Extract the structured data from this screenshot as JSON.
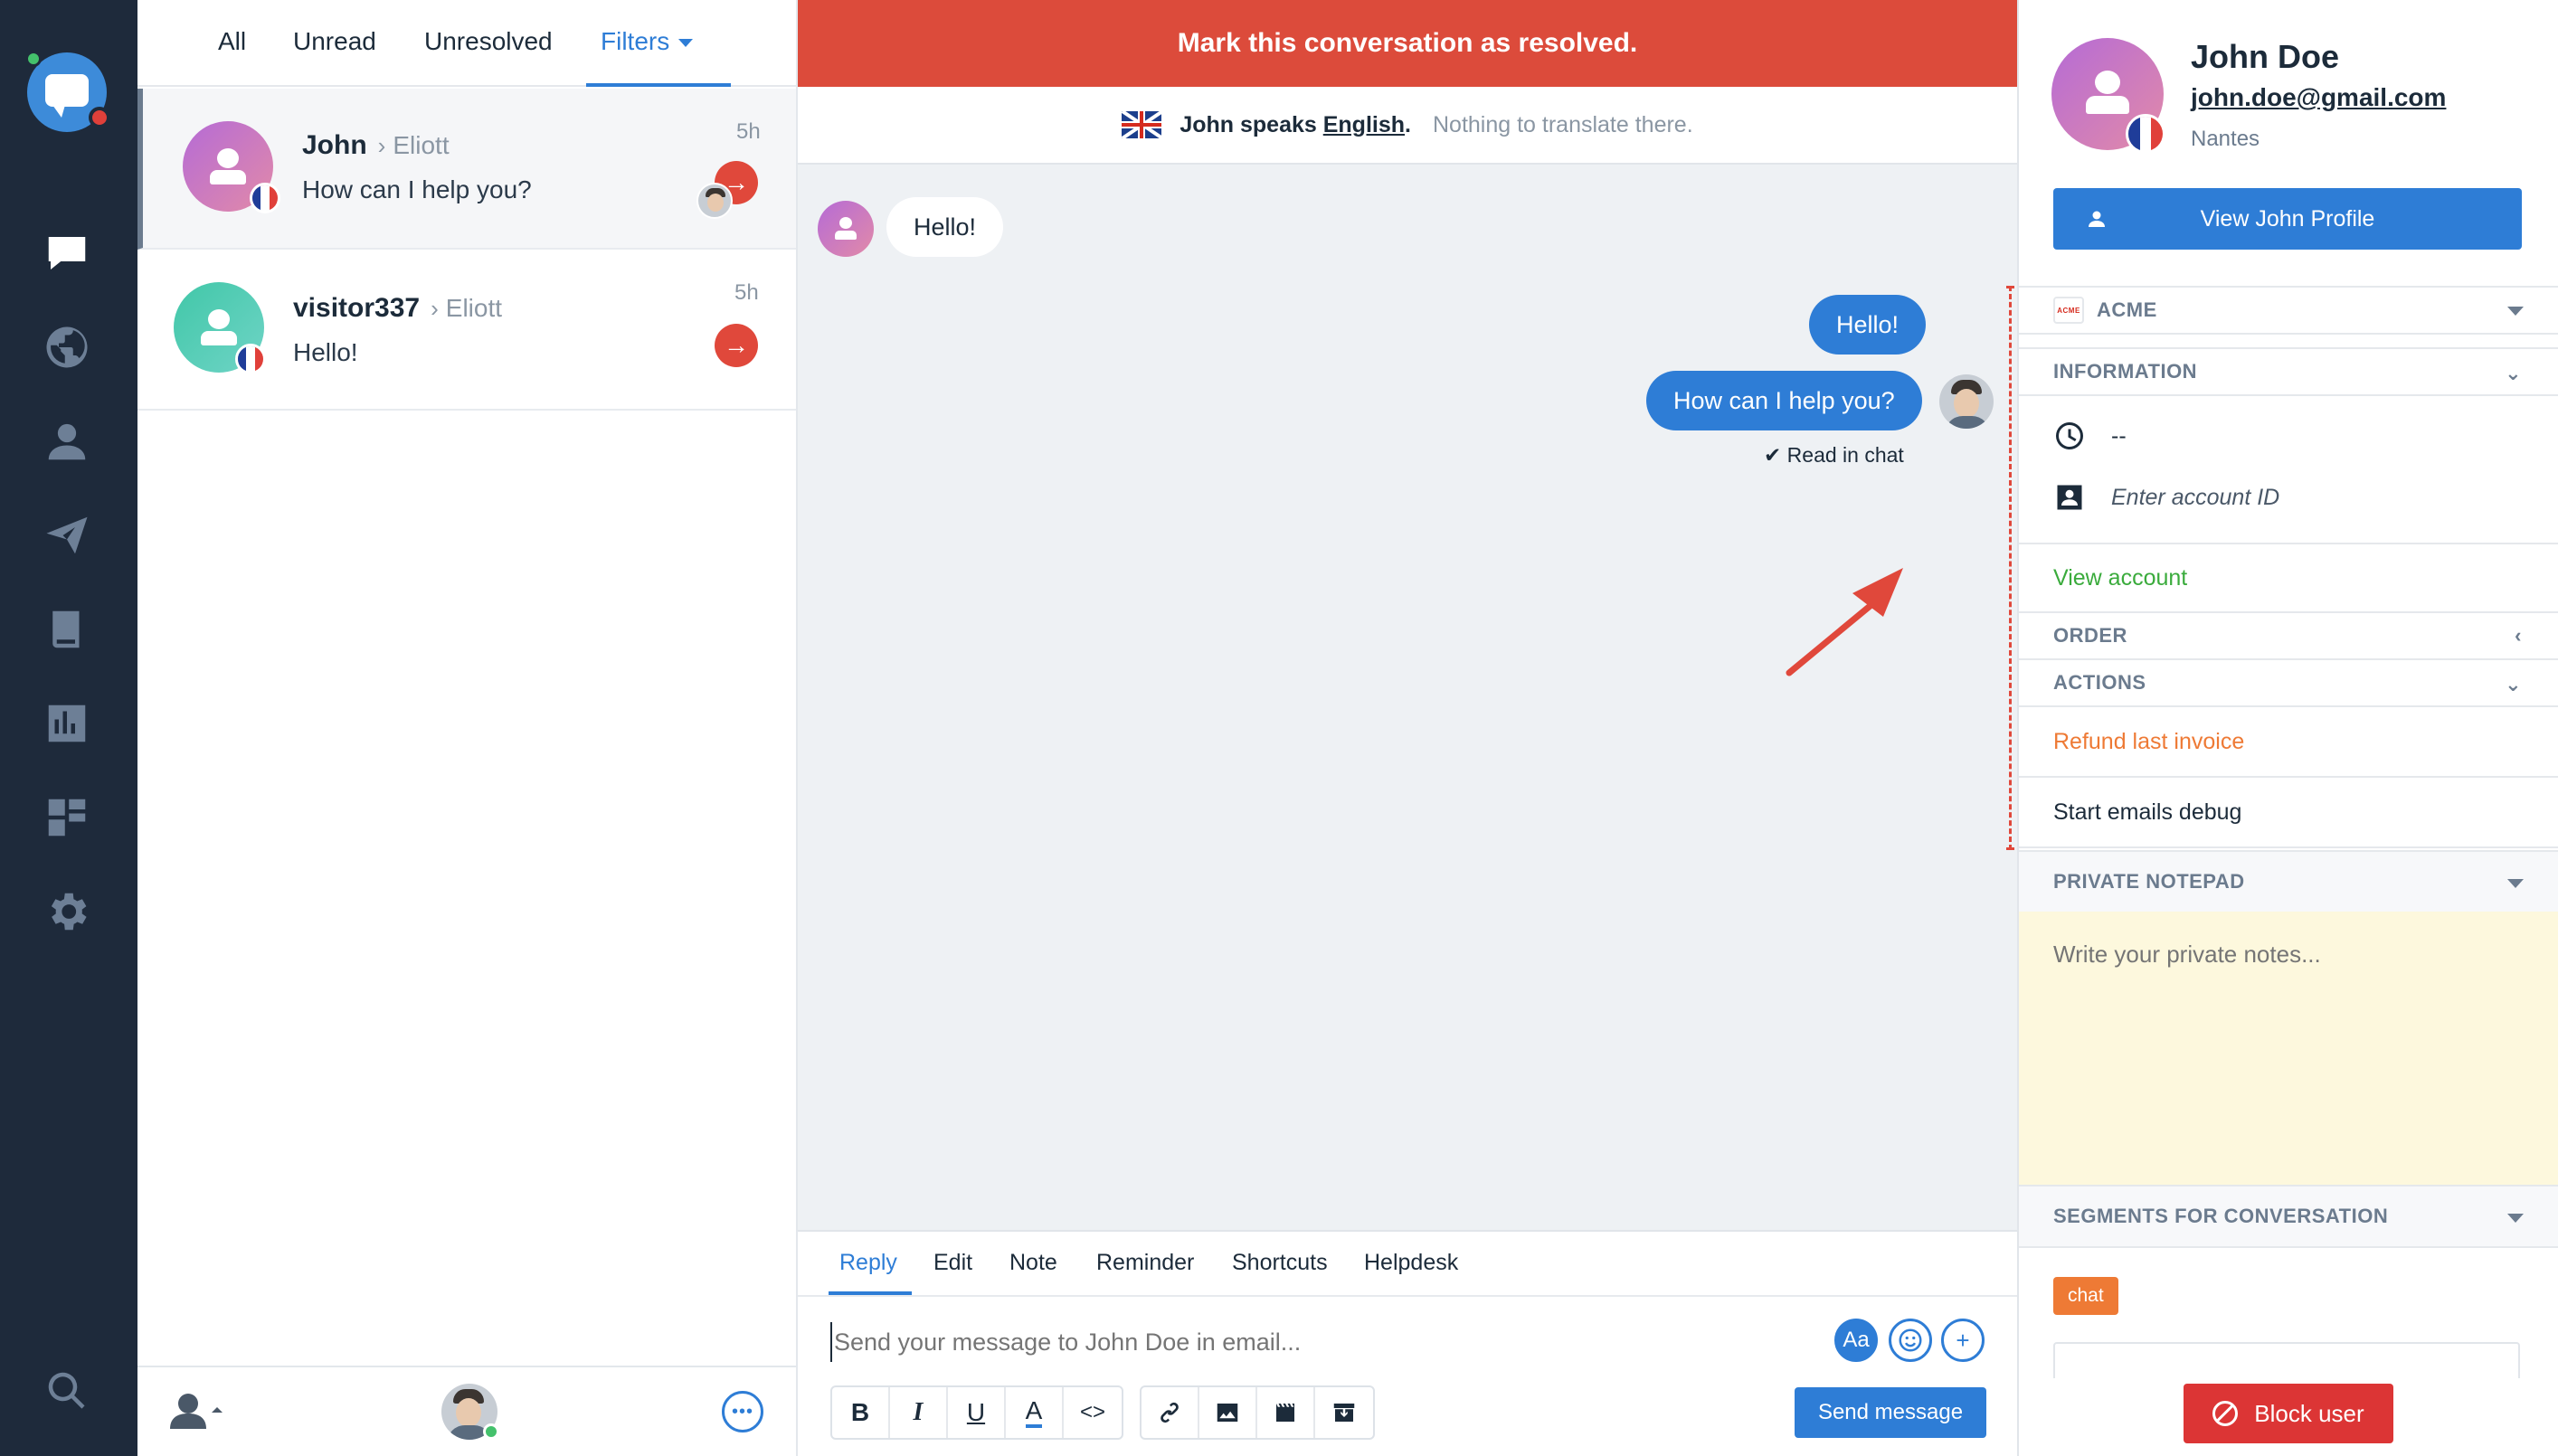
{
  "colors": {
    "brand_blue": "#2e7dd6",
    "resolve_red": "#dc4b3b",
    "rail_bg": "#1e2a3b",
    "notepad_bg": "#fdf8dd",
    "action_orange": "#ee7a35",
    "link_green": "#3aab3c"
  },
  "rail": {
    "icons": [
      "chat-logo-icon",
      "inbox-icon",
      "globe-icon",
      "contacts-icon",
      "campaigns-icon",
      "knowledge-icon",
      "analytics-icon",
      "plugins-icon",
      "settings-icon",
      "search-icon"
    ],
    "active": "inbox-icon"
  },
  "filters": {
    "tabs": [
      "All",
      "Unread",
      "Unresolved",
      "Filters"
    ],
    "active": "Filters"
  },
  "conversations": [
    {
      "name": "John",
      "agent": "Eliott",
      "message": "How can I help you?",
      "time": "5h",
      "selected": true
    },
    {
      "name": "visitor337",
      "agent": "Eliott",
      "message": "Hello!",
      "time": "5h",
      "selected": false
    }
  ],
  "chat": {
    "resolve_banner": "Mark this conversation as resolved.",
    "translate": {
      "prefix": "John speaks",
      "language": "English",
      "suffix": ".",
      "note": "Nothing to translate there."
    },
    "messages": [
      {
        "from": "visitor",
        "text": "Hello!"
      },
      {
        "from": "operator",
        "text": "Hello!"
      },
      {
        "from": "operator",
        "text": "How can I help you?"
      }
    ],
    "read_status": "✔ Read in chat"
  },
  "composer": {
    "tabs": [
      "Reply",
      "Edit",
      "Note",
      "Reminder",
      "Shortcuts",
      "Helpdesk"
    ],
    "active": "Reply",
    "placeholder": "Send your message to John Doe in email...",
    "font_button": "Aa",
    "send_label": "Send message",
    "format_tools": [
      "bold-icon",
      "italic-icon",
      "underline-icon",
      "text-color-icon",
      "code-icon"
    ],
    "insert_tools": [
      "link-icon",
      "image-icon",
      "video-icon",
      "archive-icon"
    ]
  },
  "profile": {
    "name": "John Doe",
    "email": "john.doe@gmail.com",
    "city": "Nantes",
    "view_profile_label": "View John Profile",
    "company": "ACME",
    "company_logo_text": "ACME",
    "sections": {
      "information": "INFORMATION",
      "order": "ORDER",
      "actions": "ACTIONS",
      "private_notepad": "PRIVATE NOTEPAD",
      "segments": "SEGMENTS FOR CONVERSATION"
    },
    "info": {
      "time_value": "--",
      "account_placeholder": "Enter account ID"
    },
    "view_account": "View account",
    "actions": [
      "Refund last invoice",
      "Start emails debug"
    ],
    "notepad_placeholder": "Write your private notes...",
    "segments": [
      "chat"
    ],
    "block_label": "Block user"
  }
}
